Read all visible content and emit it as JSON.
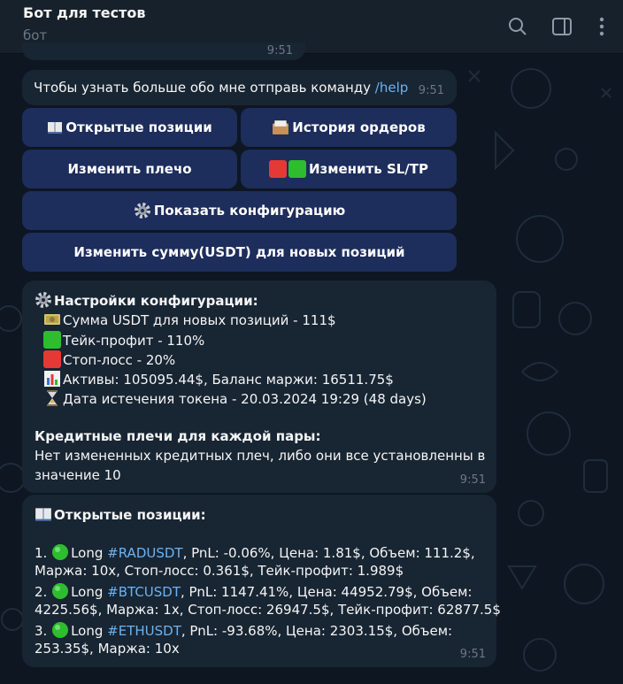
{
  "header": {
    "title": "Бот для тестов",
    "subtitle": "бот"
  },
  "messages": {
    "partial_time": "9:51",
    "help_message": {
      "text": "Чтобы узнать больше обо мне отправь команду ",
      "command": "/help",
      "time": "9:51"
    },
    "keyboard": {
      "open_positions": "Открытые позиции",
      "order_history": "История ордеров",
      "change_leverage": "Изменить плечо",
      "change_sltp": "Изменить SL/TP",
      "show_config": "Показать конфигурацию",
      "change_amount": "Изменить сумму(USDT) для новых позиций"
    },
    "config": {
      "title": "Настройки конфигурации:",
      "amount": "Сумма USDT для новых позиций - 111$",
      "take_profit": "Тейк-профит - 110%",
      "stop_loss": "Стоп-лосс - 20%",
      "assets": "Активы: 105095.44$, Баланс маржи: 16511.75$",
      "token_expiry": "Дата истечения токена - 20.03.2024 19:29 (48 days)",
      "leverage_title": "Кредитные плечи для каждой пары:",
      "leverage_line1": "Нет измененных кредитных плеч, либо они все установленны в",
      "leverage_line2": "значение 10",
      "time": "9:51"
    },
    "positions": {
      "title": "Открытые позиции:",
      "items": [
        {
          "num": "1. ",
          "side": "Long ",
          "tag": "#RADUSDT",
          "line1_rest": ", PnL: -0.06%, Цена: 1.81$, Объем: 111.2$,",
          "line2": "Маржа: 10x, Стоп-лосс: 0.361$, Тейк-профит: 1.989$"
        },
        {
          "num": "2. ",
          "side": "Long ",
          "tag": "#BTCUSDT",
          "line1_rest": ", PnL: 1147.41%, Цена: 44952.79$, Объем:",
          "line2": "4225.56$, Маржа: 1x, Стоп-лосс: 26947.5$, Тейк-профит: 62877.5$"
        },
        {
          "num": "3. ",
          "side": "Long ",
          "tag": "#ETHUSDT",
          "line1_rest": ", PnL: -93.68%, Цена: 2303.15$, Объем:",
          "line2": "253.35$, Маржа: 10x"
        }
      ],
      "time": "9:51"
    }
  },
  "icons": {
    "book": "open-book-icon",
    "folder": "card-index-icon",
    "red": "red-square-icon",
    "green": "green-square-icon",
    "gear": "gear-icon",
    "money": "dollar-banknote-icon",
    "chart": "bar-chart-icon",
    "hourglass": "hourglass-icon",
    "circle": "green-circle-icon"
  },
  "colors": {
    "background": "#0e1621",
    "header": "#17212b",
    "bubble": "#182533",
    "button": "#1d2d5c",
    "link": "#6ab3f3",
    "muted": "#6c7883"
  }
}
